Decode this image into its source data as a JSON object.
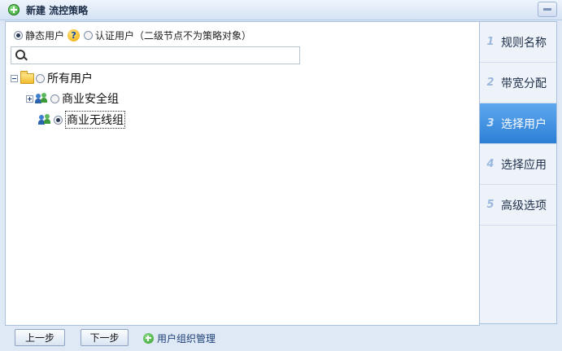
{
  "window": {
    "title": "新建 流控策略"
  },
  "user_type": {
    "static_label": "静态用户",
    "help_symbol": "?",
    "auth_label": "认证用户（二级节点不为策略对象）",
    "selected": "static"
  },
  "search": {
    "value": "",
    "placeholder": ""
  },
  "tree": {
    "root": {
      "label": "所有用户",
      "expanded": true
    },
    "children": [
      {
        "label": "商业安全组",
        "expandable": true,
        "selected": false
      },
      {
        "label": "商业无线组",
        "expandable": false,
        "selected": true
      }
    ]
  },
  "steps": [
    {
      "num": "1",
      "label": "规则名称",
      "active": false
    },
    {
      "num": "2",
      "label": "带宽分配",
      "active": false
    },
    {
      "num": "3",
      "label": "选择用户",
      "active": true
    },
    {
      "num": "4",
      "label": "选择应用",
      "active": false
    },
    {
      "num": "5",
      "label": "高级选项",
      "active": false
    }
  ],
  "footer": {
    "prev_label": "上一步",
    "next_label": "下一步",
    "group_manage_label": "用户组织管理"
  },
  "colors": {
    "accent": "#2c7fd6",
    "panel_bg": "#dfe9f6",
    "link": "#1d3e75"
  }
}
